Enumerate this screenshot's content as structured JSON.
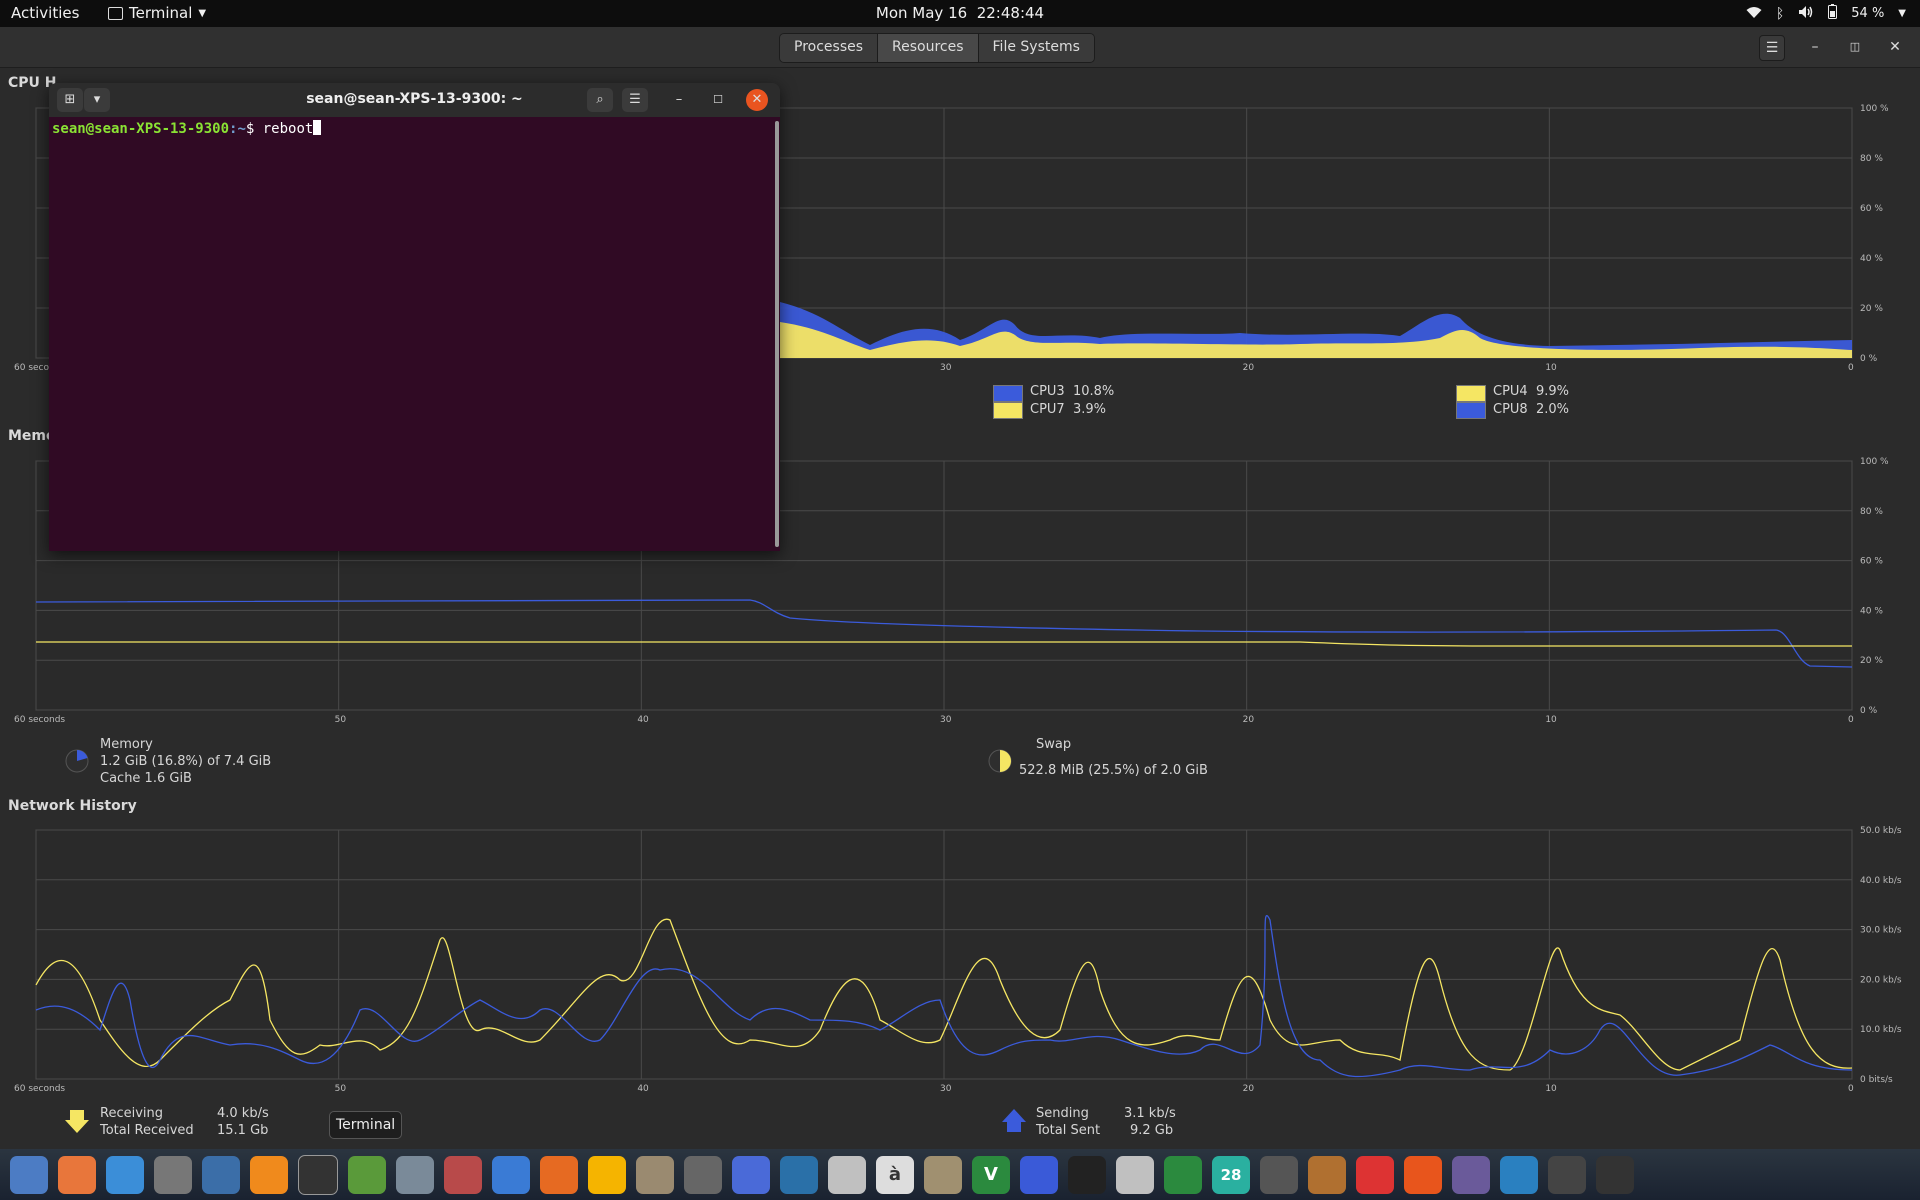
{
  "topbar": {
    "activities": "Activities",
    "app": "Terminal",
    "date": "Mon May 16",
    "time": "22:48:44",
    "battery": "54 %"
  },
  "tabs": [
    "Processes",
    "Resources",
    "File Systems"
  ],
  "sections": {
    "cpu": "CPU H",
    "memory": "Memo",
    "network": "Network History"
  },
  "axes": {
    "time_ticks": [
      "60 seconds",
      "50",
      "40",
      "30",
      "20",
      "10",
      "0"
    ],
    "pct_ticks": [
      "100 %",
      "80 %",
      "60 %",
      "40 %",
      "20 %",
      "0 %"
    ],
    "net_ticks": [
      "50.0 kb/s",
      "40.0 kb/s",
      "30.0 kb/s",
      "20.0 kb/s",
      "10.0 kb/s",
      "0 bits/s"
    ]
  },
  "cpu_legend": [
    {
      "name": "CPU3",
      "value": "10.8%",
      "color": "#3b5bdb"
    },
    {
      "name": "CPU7",
      "value": "3.9%",
      "color": "#f5e663"
    },
    {
      "name": "CPU4",
      "value": "9.9%",
      "color": "#f5e663"
    },
    {
      "name": "CPU8",
      "value": "2.0%",
      "color": "#3b5bdb"
    }
  ],
  "memory": {
    "label": "Memory",
    "usage": "1.2 GiB (16.8%) of 7.4 GiB",
    "cache": "Cache 1.6 GiB",
    "swap_label": "Swap",
    "swap_usage": "522.8 MiB (25.5%) of 2.0 GiB"
  },
  "network": {
    "receiving_label": "Receiving",
    "receiving_value": "4.0 kb/s",
    "total_received_label": "Total Received",
    "total_received_value": "15.1 Gb",
    "sending_label": "Sending",
    "sending_value": "3.1 kb/s",
    "total_sent_label": "Total Sent",
    "total_sent_value": "9.2 Gb"
  },
  "terminal": {
    "title": "sean@sean-XPS-13-9300: ~",
    "prompt_user": "sean@sean-XPS-13-9300",
    "prompt_path": ":~",
    "prompt_symbol": "$ ",
    "command": "reboot"
  },
  "tooltip": "Terminal",
  "colors": {
    "blue": "#3b5bdb",
    "yellow": "#f5e663",
    "grid": "#4a4a4a"
  },
  "dock_icons": [
    "system-monitor-icon",
    "firefox-icon",
    "help-icon",
    "settings-icon",
    "document-viewer-icon",
    "vlc-icon",
    "terminal-icon",
    "puzzle-icon",
    "image-viewer-icon",
    "graph-icon",
    "text-editor-icon",
    "software-center-icon",
    "calculator-icon",
    "files-icon",
    "disc-icon",
    "tasks-icon",
    "font-icon",
    "scanner-icon",
    "character-map-icon",
    "archive-icon",
    "vim-icon",
    "screenshot-icon",
    "music-icon",
    "pdf-icon",
    "spreadsheet-icon",
    "calendar-icon",
    "mouse-icon",
    "game-icon",
    "alert-icon",
    "update-icon",
    "camera-icon",
    "store-icon",
    "accessories-icon",
    "app-grid-icon"
  ],
  "dock_labels": {
    "vim": "V",
    "calendar": "28",
    "character": "à"
  }
}
